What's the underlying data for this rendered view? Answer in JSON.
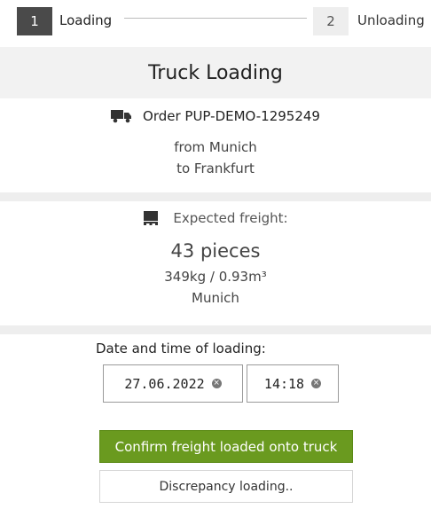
{
  "stepper": {
    "steps": [
      {
        "number": "1",
        "label": "Loading"
      },
      {
        "number": "2",
        "label": "Unloading"
      }
    ]
  },
  "header": {
    "title": "Truck Loading"
  },
  "order": {
    "text": "Order PUP-DEMO-1295249",
    "from": "from Munich",
    "to": "to Frankfurt",
    "icon": "truck-icon"
  },
  "freight": {
    "label": "Expected freight:",
    "pieces": "43 pieces",
    "weight_volume": "349kg / 0.93m³",
    "city": "Munich",
    "icon": "pallet-icon"
  },
  "loading_time": {
    "label": "Date and time of loading:",
    "date": "27.06.2022",
    "time": "14:18"
  },
  "actions": {
    "confirm_label": "Confirm freight loaded onto truck",
    "discrepancy_label": "Discrepancy loading.."
  },
  "colors": {
    "confirm": "#6a9a1f",
    "active_step": "#4a4a4a",
    "inactive_step": "#eeeeee"
  }
}
